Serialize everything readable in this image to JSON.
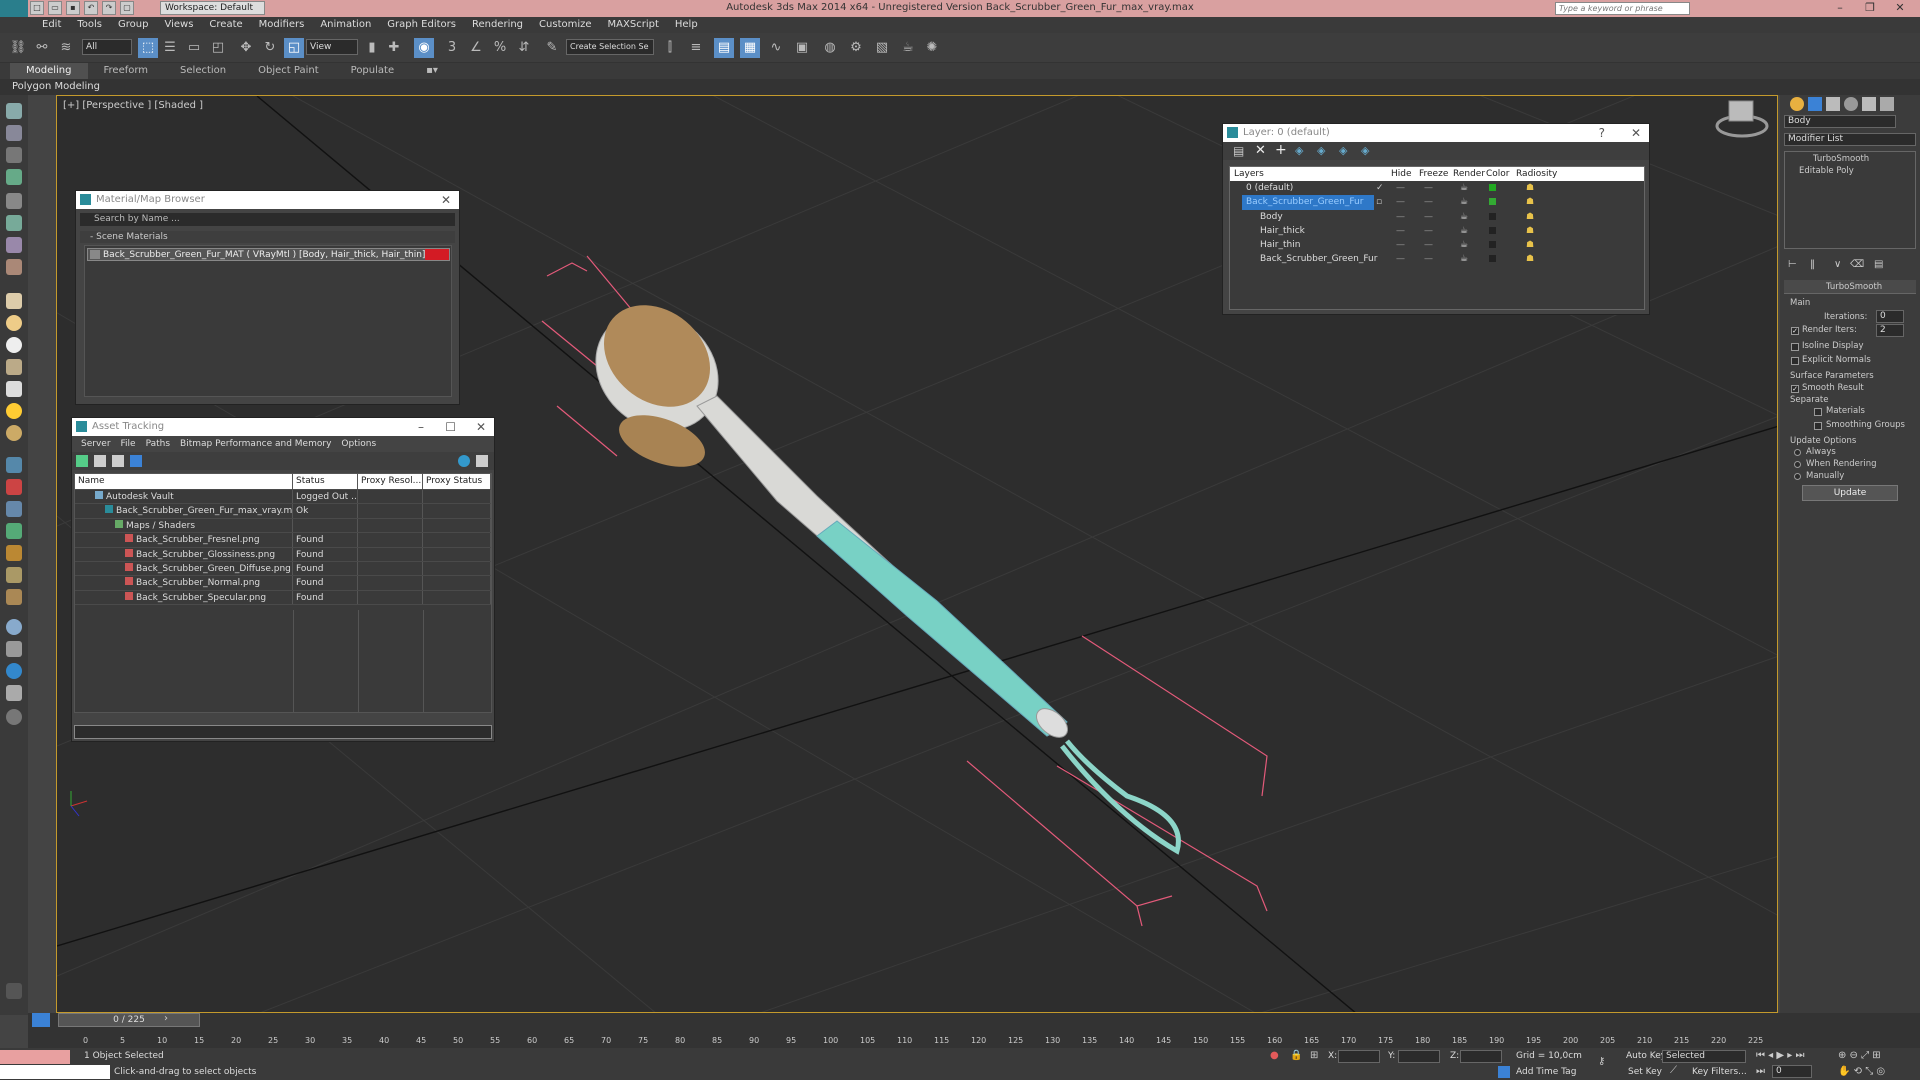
{
  "app": {
    "title": "Autodesk 3ds Max  2014 x64  - Unregistered Version   Back_Scrubber_Green_Fur_max_vray.max",
    "workspace": "Workspace: Default",
    "search_placeholder": "Type a keyword or phrase"
  },
  "menu": [
    "Edit",
    "Tools",
    "Group",
    "Views",
    "Create",
    "Modifiers",
    "Animation",
    "Graph Editors",
    "Rendering",
    "Customize",
    "MAXScript",
    "Help"
  ],
  "toolbar": {
    "filter_value": "All",
    "ref_coord_value": "View",
    "selection_set_placeholder": "Create Selection Se"
  },
  "ribbon": {
    "tabs": [
      "Modeling",
      "Freeform",
      "Selection",
      "Object Paint",
      "Populate"
    ],
    "active_tab": "Modeling",
    "sub_label": "Polygon Modeling"
  },
  "viewport": {
    "label": "[+] [Perspective ] [Shaded ]"
  },
  "material_browser": {
    "title": "Material/Map Browser",
    "search_placeholder": "Search by Name ...",
    "section": "- Scene Materials",
    "item": "Back_Scrubber_Green_Fur_MAT  ( VRayMtl )  [Body, Hair_thick, Hair_thin]"
  },
  "asset_tracking": {
    "title": "Asset Tracking",
    "menu": [
      "Server",
      "File",
      "Paths",
      "Bitmap Performance and Memory",
      "Options"
    ],
    "columns": [
      "Name",
      "Status",
      "Proxy Resol...",
      "Proxy Status"
    ],
    "rows": [
      {
        "name": "Autodesk Vault",
        "status": "Logged Out ...",
        "indent": 1
      },
      {
        "name": "Back_Scrubber_Green_Fur_max_vray.max",
        "status": "Ok",
        "indent": 2
      },
      {
        "name": "Maps / Shaders",
        "status": "",
        "indent": 3
      },
      {
        "name": "Back_Scrubber_Fresnel.png",
        "status": "Found",
        "indent": 4
      },
      {
        "name": "Back_Scrubber_Glossiness.png",
        "status": "Found",
        "indent": 4
      },
      {
        "name": "Back_Scrubber_Green_Diffuse.png",
        "status": "Found",
        "indent": 4
      },
      {
        "name": "Back_Scrubber_Normal.png",
        "status": "Found",
        "indent": 4
      },
      {
        "name": "Back_Scrubber_Specular.png",
        "status": "Found",
        "indent": 4
      }
    ]
  },
  "layers": {
    "title": "Layer: 0 (default)",
    "columns": [
      "Layers",
      "Hide",
      "Freeze",
      "Render",
      "Color",
      "Radiosity"
    ],
    "rows": [
      {
        "name": "0 (default)",
        "color": "#22aa22",
        "indent": 1
      },
      {
        "name": "Back_Scrubber_Green_Fur",
        "color": "#33aa33",
        "indent": 1,
        "selected": true
      },
      {
        "name": "Body",
        "color": "#222222",
        "indent": 2
      },
      {
        "name": "Hair_thick",
        "color": "#222222",
        "indent": 2
      },
      {
        "name": "Hair_thin",
        "color": "#222222",
        "indent": 2
      },
      {
        "name": "Back_Scrubber_Green_Fur",
        "color": "#222222",
        "indent": 2
      }
    ]
  },
  "command_panel": {
    "object_name": "Body",
    "modifier_list": "Modifier List",
    "stack": [
      "TurboSmooth",
      "Editable Poly"
    ],
    "rollout_title": "TurboSmooth",
    "main_label": "Main",
    "iterations_label": "Iterations:",
    "iterations_value": "0",
    "render_iters_label": "Render Iters:",
    "render_iters_value": "2",
    "isoline": "Isoline Display",
    "explicit_normals": "Explicit Normals",
    "surface_params": "Surface Parameters",
    "smooth_result": "Smooth Result",
    "separate": "Separate",
    "materials": "Materials",
    "smoothing_groups": "Smoothing Groups",
    "update_options": "Update Options",
    "always": "Always",
    "when_rendering": "When Rendering",
    "manually": "Manually",
    "update_button": "Update"
  },
  "timeline": {
    "slider": "0 / 225",
    "ticks": [
      "0",
      "5",
      "10",
      "15",
      "20",
      "25",
      "30",
      "35",
      "40",
      "45",
      "50",
      "55",
      "60",
      "65",
      "70",
      "75",
      "80",
      "85",
      "90",
      "95",
      "100",
      "105",
      "110",
      "115",
      "120",
      "125",
      "130",
      "135",
      "140",
      "145",
      "150",
      "155",
      "160",
      "165",
      "170",
      "175",
      "180",
      "185",
      "190",
      "195",
      "200",
      "205",
      "210",
      "215",
      "220",
      "225"
    ]
  },
  "status": {
    "selected": "1 Object Selected",
    "prompt": "Click-and-drag to select objects",
    "x_label": "X:",
    "y_label": "Y:",
    "z_label": "Z:",
    "grid": "Grid = 10,0cm",
    "add_time_tag": "Add Time Tag",
    "auto_key": "Auto Key",
    "set_key": "Set Key",
    "key_mode": "Selected",
    "key_filters": "Key Filters...",
    "frame": "0"
  }
}
